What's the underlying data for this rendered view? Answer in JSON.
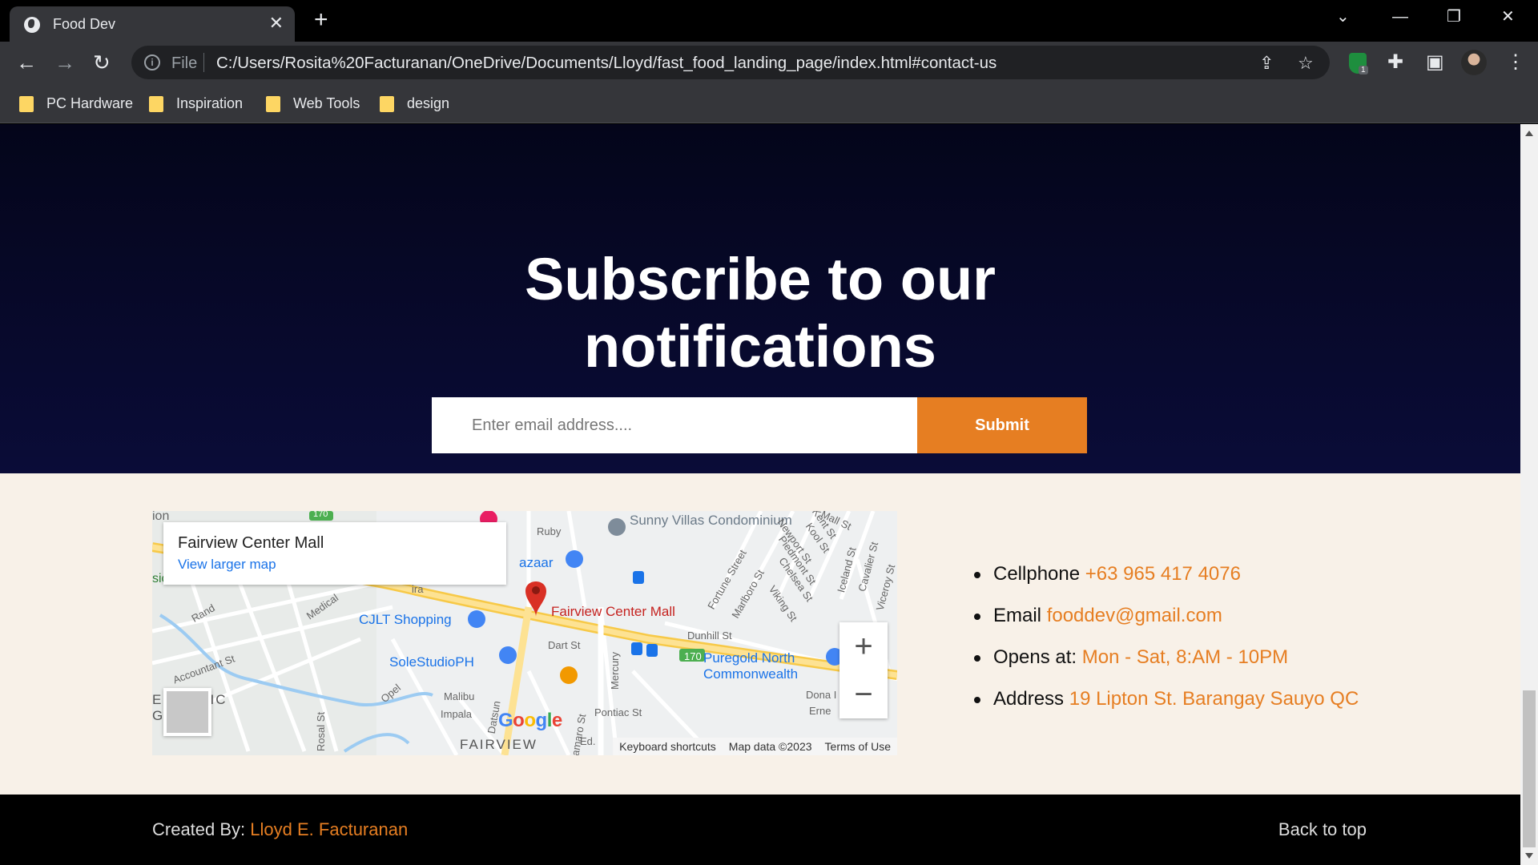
{
  "browser": {
    "tab_title": "Food Dev",
    "new_tab_label": "+",
    "url_scheme": "File",
    "url": "C:/Users/Rosita%20Facturanan/OneDrive/Documents/Lloyd/fast_food_landing_page/index.html#contact-us",
    "extension_badge": "1",
    "bookmarks": [
      "PC Hardware",
      "Inspiration",
      "Web Tools",
      "design"
    ]
  },
  "subscribe": {
    "title": "Subscribe to our notifications",
    "email_placeholder": "Enter email address....",
    "submit_label": "Submit"
  },
  "map": {
    "place_name": "Fairview Center Mall",
    "larger_map_link": "View larger map",
    "labels": {
      "sunny_villas": "Sunny Villas Condominium",
      "ruby": "Ruby",
      "bazaar": "azaar",
      "cjlt": "CJLT Shopping",
      "pin_label": "Fairview Center Mall",
      "solestudio": "SoleStudioPH",
      "puregold": "Puregold North Commonwealth",
      "fairview": "FAIRVIEW",
      "classic": "ES  ASSIC",
      "gardens": "G    NS",
      "route_170": "170",
      "dart": "Dart St",
      "dunhill": "Dunhill St",
      "pontiac": "Pontiac St",
      "malibu": "Malibu",
      "impala": "Impala",
      "medical": "Medical",
      "rand": "Rand",
      "accountant": "Accountant St",
      "opel": "Opel",
      "mercury": "Mercury",
      "datsun": "Datsun",
      "dona": "Dona I",
      "erne": "Erne",
      "fortune": "Fortune Street",
      "marlboro": "Marlboro St",
      "viking": "Viking St",
      "chelsea": "Chelsea St",
      "newport": "Newport St",
      "piedmont": "Piedmont St",
      "kool": "Kool St",
      "kent": "Kent St",
      "mall": "Mall St",
      "iceland": "Iceland St",
      "cavalier": "Cavalier St",
      "viceroy": "Viceroy St",
      "rosal": "Rosal St",
      "cion": "ion",
      "ira": "ira",
      "sic": "sic",
      "ed": "Ed.",
      "amaro": "amaro St"
    },
    "google": "Google",
    "footer": [
      "Keyboard shortcuts",
      "Map data ©2023",
      "Terms of Use"
    ],
    "zoom_in": "+",
    "zoom_out": "−"
  },
  "contact": [
    {
      "label": "Cellphone",
      "value": "+63 965 417 4076"
    },
    {
      "label": "Email",
      "value": "fooddev@gmail.com"
    },
    {
      "label": "Opens at:",
      "value": "Mon - Sat, 8:AM - 10PM"
    },
    {
      "label": "Address",
      "value": "19 Lipton St. Barangay Sauyo QC"
    }
  ],
  "footer": {
    "created_by_label": "Created By:",
    "author": "Lloyd E. Facturanan",
    "back_to_top": "Back to top"
  },
  "colors": {
    "accent": "#e67e22",
    "hero_top": "#04051a",
    "hero_bottom": "#0a0c38",
    "section_bg": "#f8f1e8",
    "footer_bg": "#000000"
  }
}
